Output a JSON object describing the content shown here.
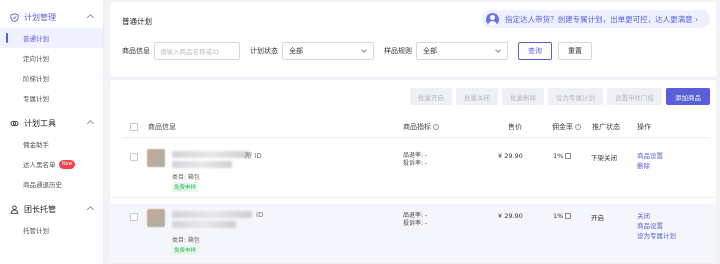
{
  "sidebar": {
    "groups": [
      {
        "label": "计划管理",
        "items": [
          "普通计划",
          "定向计划",
          "阶梯计划",
          "专属计划"
        ]
      },
      {
        "label": "计划工具",
        "items": [
          "佣金助手",
          "达人黑名单",
          "商品通退历史"
        ],
        "badge": "New"
      },
      {
        "label": "团长托管",
        "items": [
          "托管计划"
        ]
      }
    ]
  },
  "header": {
    "title": "普通计划",
    "promo": "指定达人带货？创建专属计划，出单更可控，达人更满意 ›"
  },
  "filters": {
    "product_label": "商品信息",
    "product_placeholder": "请输入商品名称或ID",
    "status_label": "计划状态",
    "status_value": "全部",
    "sample_label": "样品规则",
    "sample_value": "全部",
    "query_label": "查询",
    "reset_label": "重置"
  },
  "toolbar": [
    "批量开启",
    "批量关闭",
    "批量删除",
    "设为专属计划",
    "设置申样门槛"
  ],
  "toolbar_primary": "添加商品",
  "table": {
    "headers": {
      "product": "商品信息",
      "metrics": "商品指标",
      "price": "售价",
      "commission": "佣金率",
      "status": "推广状态",
      "actions": "操作"
    },
    "rows": [
      {
        "id_suffix": "所 ID",
        "category": "类目: 箱包",
        "tag": "免费申样",
        "metric1": "品退率: -",
        "metric2": "投诉率: -",
        "price": "¥ 29.90",
        "commission": "1%",
        "status": "下架关闭",
        "actions": [
          "商品设置",
          "删除"
        ]
      },
      {
        "id_suffix": "ID",
        "category": "类目: 箱包",
        "tag": "免费申样",
        "metric1": "品退率: -",
        "metric2": "投诉率: -",
        "price": "¥ 29.90",
        "commission": "1%",
        "status": "开启",
        "actions": [
          "关闭",
          "商品设置",
          "设为专属计划"
        ]
      }
    ]
  },
  "colors": {
    "accent": "#5a5fd8",
    "tag_green": "#2bb15a",
    "new_badge": "#f5414e"
  }
}
